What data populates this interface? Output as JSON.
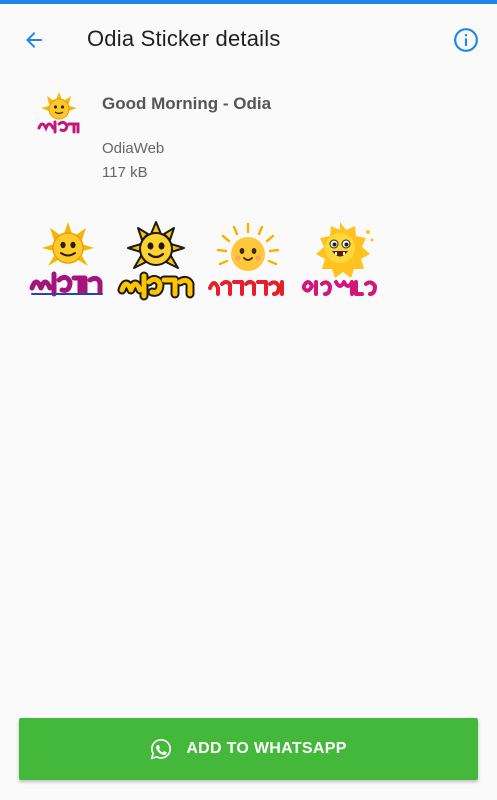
{
  "appbar": {
    "title": "Odia Sticker details",
    "back_icon": "arrow-back-icon",
    "info_icon": "info-icon",
    "accent_color": "#1e88e5"
  },
  "pack": {
    "name": "Good Morning - Odia",
    "publisher": "OdiaWeb",
    "size": "117 kB"
  },
  "stickers": [
    {
      "name": "sticker-suprabhat-1"
    },
    {
      "name": "sticker-suprabhat-2"
    },
    {
      "name": "sticker-subhasakala"
    },
    {
      "name": "sticker-good-morning"
    }
  ],
  "action": {
    "label": "ADD TO WHATSAPP",
    "icon": "whatsapp-icon",
    "color": "#43b83a"
  }
}
